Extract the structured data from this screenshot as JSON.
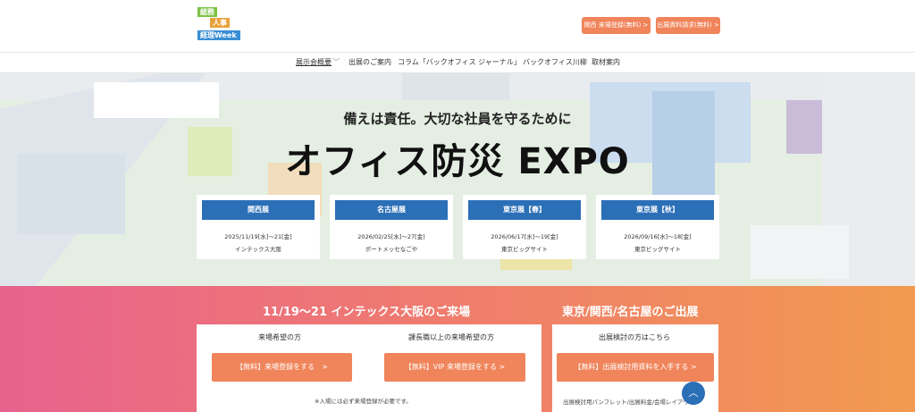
{
  "header": {
    "logo_lines": [
      "総務",
      "人事",
      "経理Week"
    ],
    "btn_kansai_register": "関西 来場登録(無料) >",
    "btn_exhibit_docs": "出展資料請求(無料) >"
  },
  "nav": {
    "items": [
      "展示会概要",
      "出展のご案内",
      "コラム「バックオフィス ジャーナル」",
      "バックオフィス川柳",
      "取材案内"
    ]
  },
  "hero": {
    "tagline": "備えは責任。大切な社員を守るために",
    "title": "オフィス防災 EXPO",
    "venues": [
      {
        "name": "関西展",
        "dates": "2025/11/19[水]～21[金]",
        "place": "インテックス大阪"
      },
      {
        "name": "名古屋展",
        "dates": "2026/02/25[水]～27[金]",
        "place": "ポートメッセなごや"
      },
      {
        "name": "東京展【春】",
        "dates": "2026/06/17[水]～19[金]",
        "place": "東京ビッグサイト"
      },
      {
        "name": "東京展【秋】",
        "dates": "2026/09/16[水]～18[金]",
        "place": "東京ビッグサイト"
      }
    ]
  },
  "cta": {
    "left_title": "11/19～21 インテックス大阪のご来場",
    "right_title": "東京/関西/名古屋のご出展",
    "visitor_label": "来場希望の方",
    "vip_label": "課長職以上の来場希望の方",
    "exhibit_label": "出展検討の方はこちら",
    "btn_register": "【無料】来場登録をする　>",
    "btn_vip": "【無料】VIP 来場登録をする >",
    "btn_exhibit": "【無料】出展検討用資料を入手する >",
    "note_register": "※入場には必ず来場登録が必要です。",
    "note_exhibit": "出展検討用パンフレット/出展料金/会場レイアウ"
  },
  "icons": {
    "scroll_top": "chevron-up-icon",
    "nav_dropdown": "chevron-down-icon"
  },
  "colors": {
    "accent_blue": "#2b6fb7",
    "accent_orange": "#f0845a",
    "gradient_pink": "#e8628e",
    "gradient_orange": "#f29a4f"
  }
}
